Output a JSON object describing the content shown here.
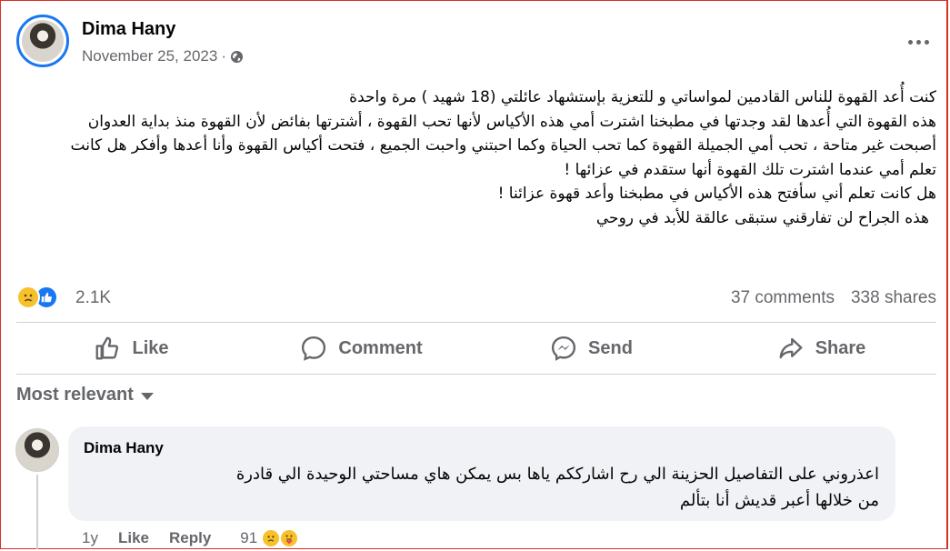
{
  "post": {
    "author": "Dima Hany",
    "date": "November 25, 2023",
    "separator": "·",
    "privacy_icon": "globe-icon",
    "more_icon": "more-options-icon",
    "text_lines": [
      "كنت أُعد القهوة للناس القادمين لمواساتي و للتعزية بإستشهاد عائلتي  (18 شهيد ) مرة واحدة",
      "هذه القهوة التي أُعدها لقد وجدتها في مطبخنا اشترت أمي هذه الأكياس لأنها تحب القهوة ، أشترتها  بفائض لأن القهوة منذ بداية العدوان أصبحت غير متاحة  ، تحب أمي الجميلة  القهوة كما تحب الحياة وكما احبتني واحبت الجميع  ،   فتحت أكياس القهوة وأنا أعدها  وأفكر  هل كانت تعلم أمي عندما اشترت تلك القهوة أنها ستقدم في عزائها !",
      "هل كانت تعلم أني سأفتح هذه الأكياس في مطبخنا وأعد قهوة  عزائنا !",
      "هذه الجراح لن تفارقني ستبقى عالقة للأبد في روحي"
    ]
  },
  "stats": {
    "reaction_icons": [
      "sad-react-icon",
      "like-react-icon"
    ],
    "reaction_count": "2.1K",
    "comments": "37 comments",
    "shares": "338 shares"
  },
  "actions": {
    "like": "Like",
    "comment": "Comment",
    "send": "Send",
    "share": "Share"
  },
  "comments_section": {
    "filter_label": "Most relevant",
    "comments": [
      {
        "author": "Dima Hany",
        "text_lines": [
          "اعذروني على التفاصيل الحزينة الي رح اشارككم ياها بس يمكن هاي مساحتي الوحيدة الي قادرة",
          "من خلالها أعبر قديش أنا بتألم"
        ],
        "age": "1y",
        "like_label": "Like",
        "reply_label": "Reply",
        "reaction_count": "91",
        "reaction_icons": [
          "sad-react-icon",
          "care-react-icon"
        ]
      }
    ]
  },
  "colors": {
    "accent": "#1877f2",
    "secondary_text": "#65676b",
    "bubble_bg": "#f0f2f5"
  }
}
